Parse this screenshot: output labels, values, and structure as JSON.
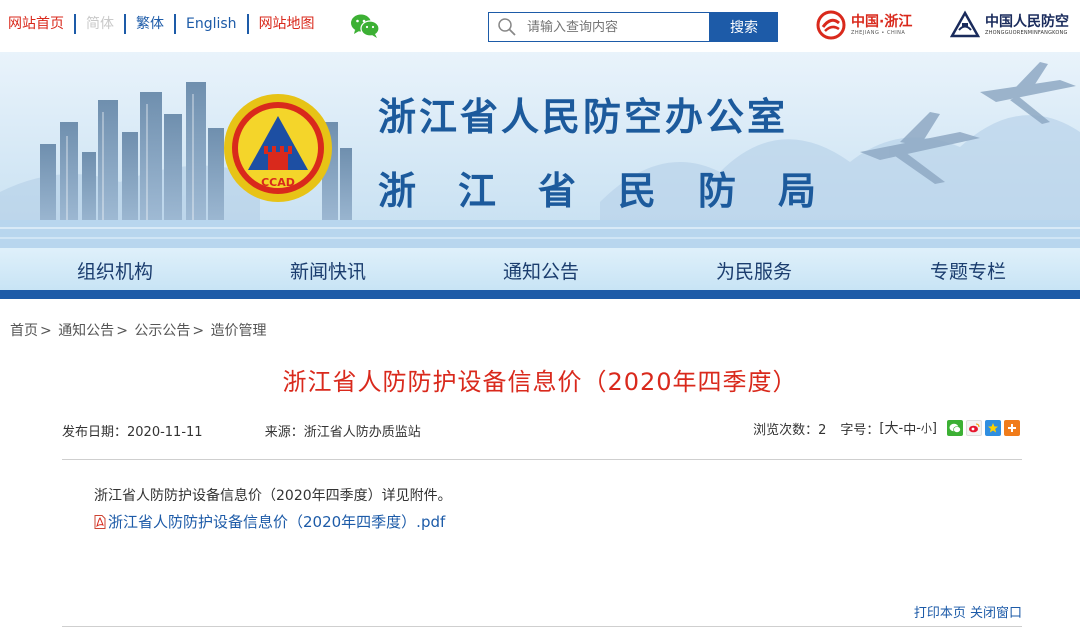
{
  "topbar": {
    "links": [
      {
        "label": "网站首页"
      },
      {
        "label": "简体"
      },
      {
        "label": "繁体"
      },
      {
        "label": "English"
      },
      {
        "label": "网站地图"
      }
    ],
    "search_placeholder": "请输入查询内容",
    "search_button": "搜索",
    "logo_zhejiang": {
      "title": "中国·浙江",
      "subtitle": "ZHEJIANG • CHINA"
    },
    "logo_renfang": {
      "title": "中国人民防空",
      "subtitle": "ZHONGGUORENMINFANGKONG"
    }
  },
  "banner": {
    "emblem_text": "CCAD",
    "title": "浙江省人民防空办公室",
    "subtitle": "浙江省民防局"
  },
  "nav": {
    "items": [
      "组织机构",
      "新闻快讯",
      "通知公告",
      "为民服务",
      "专题专栏"
    ]
  },
  "breadcrumb": [
    "首页",
    "通知公告",
    "公示公告",
    "造价管理"
  ],
  "article": {
    "title": "浙江省人防防护设备信息价（2020年四季度）",
    "publish_label": "发布日期：",
    "publish_date": "2020-11-11",
    "source_label": "来源：",
    "source": "浙江省人防办质监站",
    "views_label": "浏览次数：",
    "views": "2",
    "font_label": "字号：",
    "font_sizes": [
      "大",
      "中",
      "小"
    ],
    "body": "浙江省人防防护设备信息价（2020年四季度）详见附件。",
    "attachment": "浙江省人防防护设备信息价（2020年四季度）.pdf"
  },
  "footer_links": {
    "print": "打印本页",
    "close": "关闭窗口"
  },
  "colors": {
    "brand_blue": "#1d5ba8",
    "title_red": "#d9291c",
    "banner_text": "#1c5a9c"
  }
}
